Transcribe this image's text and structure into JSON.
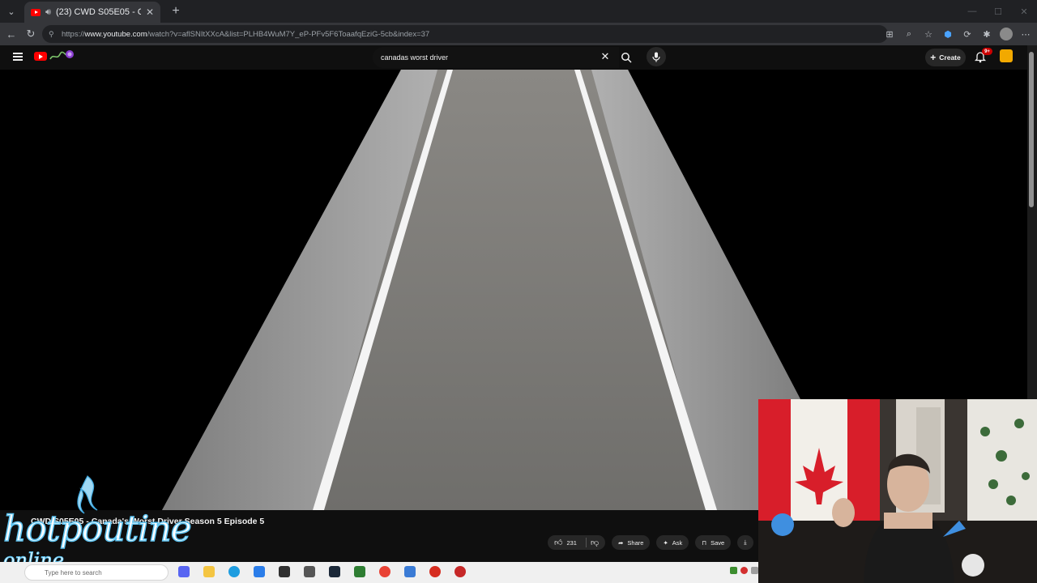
{
  "browser": {
    "tab": {
      "title": "(23) CWD S05E05 - Canada's Worst",
      "close": "✕"
    },
    "new_tab": "+",
    "address": {
      "prefix": "https://",
      "domain": "www.youtube.com",
      "path": "/watch?v=aflSNItXXcA&list=PLHB4WuM7Y_eP-PFv5F6ToaafqEziG-5cb&index=37"
    }
  },
  "youtube": {
    "search": {
      "query": "canadas worst driver",
      "clear": "✕"
    },
    "create_label": "Create",
    "notification_badge": "9+",
    "video": {
      "title": "CWD S05E05 - Canada's Worst Driver Season 5 Episode 5"
    },
    "actions": {
      "likes": "231",
      "share": "Share",
      "ask": "Ask",
      "save": "Save"
    }
  },
  "overlay": {
    "brand_line1": "hotpoutine",
    "brand_line2": "online"
  },
  "taskbar": {
    "search_placeholder": "Type here to search"
  },
  "colors": {
    "youtube_red": "#ff0000",
    "accent_blue": "#5ec3f0",
    "page_bg": "#0f0f0f"
  }
}
